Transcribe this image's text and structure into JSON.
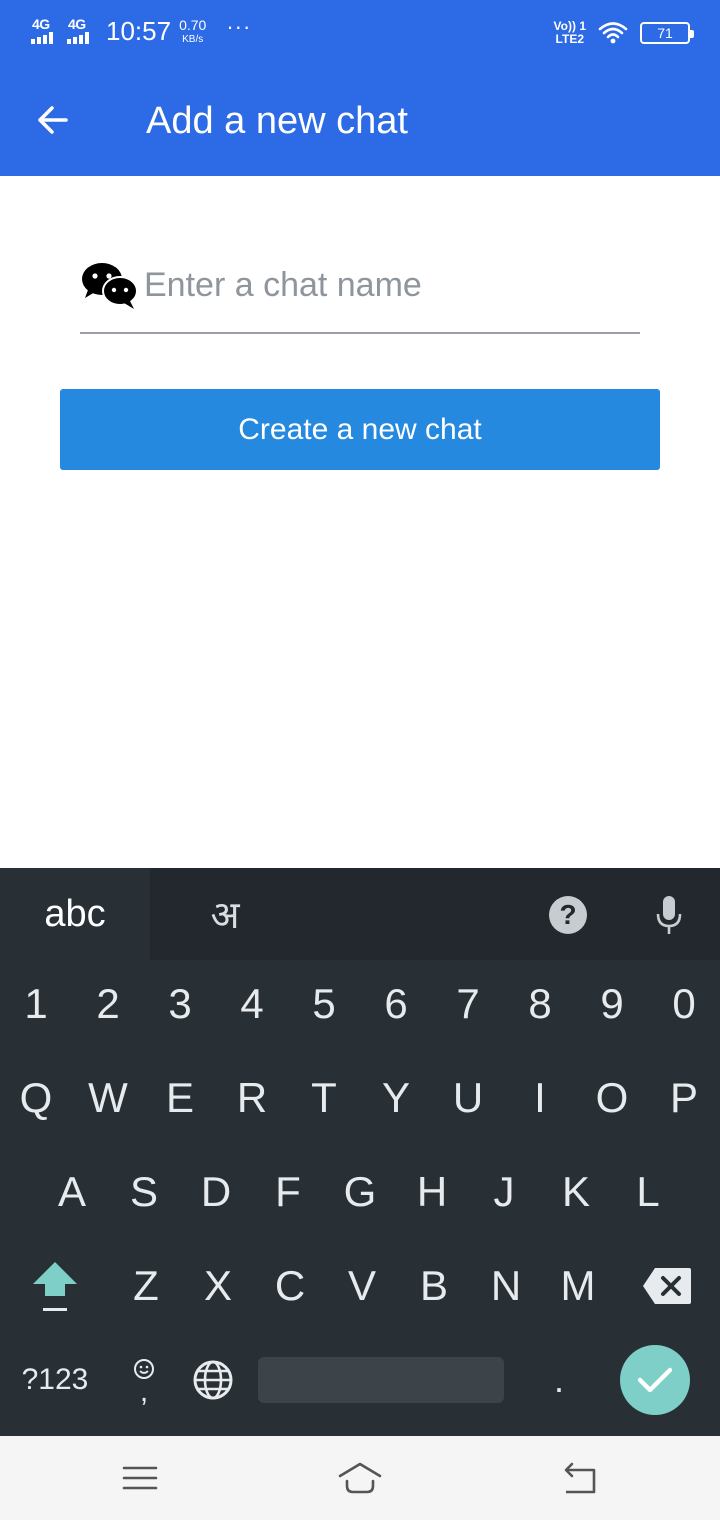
{
  "status_bar": {
    "network_1": "4G",
    "network_2": "4G",
    "time": "10:57",
    "speed_value": "0.70",
    "speed_unit": "KB/s",
    "more": "···",
    "volte_top": "Vo)) 1",
    "volte_bottom": "LTE2",
    "battery": "71"
  },
  "app_bar": {
    "title": "Add a new chat",
    "back_icon": "arrow-left-icon"
  },
  "form": {
    "chat_icon": "wechat-icon",
    "input_value": "",
    "input_placeholder": "Enter a chat name",
    "create_button_label": "Create a new chat"
  },
  "keyboard": {
    "tab_abc": "abc",
    "tab_hindi": "अ",
    "help": "?",
    "row_numbers": [
      "1",
      "2",
      "3",
      "4",
      "5",
      "6",
      "7",
      "8",
      "9",
      "0"
    ],
    "row_qwerty": [
      "Q",
      "W",
      "E",
      "R",
      "T",
      "Y",
      "U",
      "I",
      "O",
      "P"
    ],
    "row_asdf": [
      "A",
      "S",
      "D",
      "F",
      "G",
      "H",
      "J",
      "K",
      "L"
    ],
    "row_zxcv": [
      "Z",
      "X",
      "C",
      "V",
      "B",
      "N",
      "M"
    ],
    "symbols_label": "?123",
    "comma": ",",
    "period": ".",
    "accent_color": "#7dcfc7",
    "shift_color": "#7dcfc7"
  },
  "colors": {
    "app_bar": "#2d6ae6",
    "button": "#2489df",
    "keyboard_bg": "#283036"
  }
}
